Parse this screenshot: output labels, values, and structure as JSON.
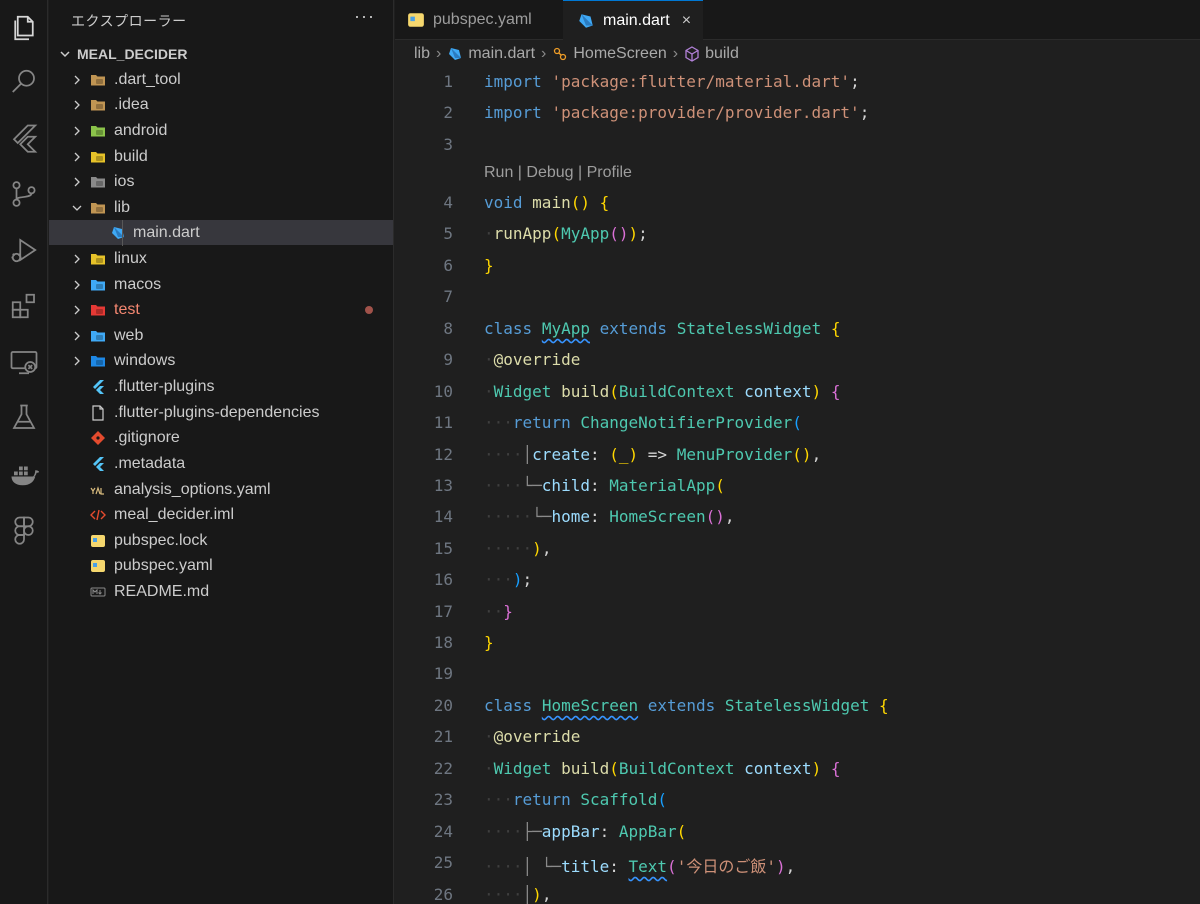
{
  "explorer": {
    "title": "エクスプローラー",
    "more": "···",
    "project": "MEAL_DECIDER",
    "items": [
      {
        "label": ".dart_tool",
        "icon": "folder-icon",
        "color": "#c09553"
      },
      {
        "label": ".idea",
        "icon": "folder-idea-icon",
        "color": "#c09553"
      },
      {
        "label": "android",
        "icon": "folder-android-icon",
        "color": "#8bc34a"
      },
      {
        "label": "build",
        "icon": "folder-build-icon",
        "color": "#e6c229"
      },
      {
        "label": "ios",
        "icon": "folder-ios-icon",
        "color": "#8a8a8a"
      },
      {
        "label": "lib",
        "icon": "folder-lib-icon",
        "color": "#c09553"
      },
      {
        "label": "main.dart",
        "icon": "dart-file-icon",
        "color": "#3fa9f5"
      },
      {
        "label": "linux",
        "icon": "folder-linux-icon",
        "color": "#e6c229"
      },
      {
        "label": "macos",
        "icon": "folder-macos-icon",
        "color": "#3fa9f5"
      },
      {
        "label": "test",
        "icon": "folder-test-icon",
        "color": "#e53935"
      },
      {
        "label": "web",
        "icon": "folder-web-icon",
        "color": "#3fa9f5"
      },
      {
        "label": "windows",
        "icon": "folder-windows-icon",
        "color": "#1e88e5"
      },
      {
        "label": ".flutter-plugins",
        "icon": "flutter-file-icon",
        "color": "#54c5f8"
      },
      {
        "label": ".flutter-plugins-dependencies",
        "icon": "file-icon",
        "color": "#cccccc"
      },
      {
        "label": ".gitignore",
        "icon": "git-file-icon",
        "color": "#e44b2e"
      },
      {
        "label": ".metadata",
        "icon": "flutter-file-icon",
        "color": "#54c5f8"
      },
      {
        "label": "analysis_options.yaml",
        "icon": "yaml-file-icon",
        "color": "#d7ba7d"
      },
      {
        "label": "meal_decider.iml",
        "icon": "xml-file-icon",
        "color": "#e44b2e"
      },
      {
        "label": "pubspec.lock",
        "icon": "pubspec-lock-icon",
        "color": "#f5d76e"
      },
      {
        "label": "pubspec.yaml",
        "icon": "pubspec-yaml-icon",
        "color": "#f5d76e"
      },
      {
        "label": "README.md",
        "icon": "markdown-file-icon",
        "color": "#8a8a8a"
      }
    ]
  },
  "tabs": [
    {
      "label": "pubspec.yaml",
      "icon": "pubspec-yaml-icon"
    },
    {
      "label": "main.dart",
      "icon": "dart-file-icon",
      "close": "×"
    }
  ],
  "breadcrumb": [
    "lib",
    "main.dart",
    "HomeScreen",
    "build"
  ],
  "codelens": "Run | Debug | Profile",
  "line_numbers": [
    "1",
    "2",
    "3",
    "4",
    "5",
    "6",
    "7",
    "8",
    "9",
    "10",
    "11",
    "12",
    "13",
    "14",
    "15",
    "16",
    "17",
    "18",
    "19",
    "20",
    "21",
    "22",
    "23",
    "24",
    "25",
    "26"
  ],
  "code": {
    "l1": [
      "import",
      "'package:flutter/material.dart'",
      ";"
    ],
    "l2": [
      "import",
      "'package:provider/provider.dart'",
      ";"
    ],
    "l4": [
      "void",
      "main",
      "()",
      "{"
    ],
    "l5": [
      "runApp",
      "(",
      "MyApp",
      "()",
      ")",
      ";"
    ],
    "l6": [
      "}"
    ],
    "l8": [
      "class",
      "MyApp",
      "extends",
      "StatelessWidget",
      "{"
    ],
    "l9": [
      "@override"
    ],
    "l10": [
      "Widget",
      "build",
      "(",
      "BuildContext",
      "context",
      ")",
      "{"
    ],
    "l11": [
      "return",
      "ChangeNotifierProvider",
      "("
    ],
    "l12": [
      "create",
      ":",
      "(_)",
      "=>",
      "MenuProvider",
      "()",
      ","
    ],
    "l13": [
      "child",
      ":",
      "MaterialApp",
      "("
    ],
    "l14": [
      "home",
      ":",
      "HomeScreen",
      "()",
      ","
    ],
    "l15": [
      ")",
      ","
    ],
    "l16": [
      ")",
      ";"
    ],
    "l17": [
      "}"
    ],
    "l18": [
      "}"
    ],
    "l20": [
      "class",
      "HomeScreen",
      "extends",
      "StatelessWidget",
      "{"
    ],
    "l21": [
      "@override"
    ],
    "l22": [
      "Widget",
      "build",
      "(",
      "BuildContext",
      "context",
      ")",
      "{"
    ],
    "l23": [
      "return",
      "Scaffold",
      "("
    ],
    "l24": [
      "appBar",
      ":",
      "AppBar",
      "("
    ],
    "l25": [
      "title",
      ":",
      "Text",
      "(",
      "'今日のご飯'",
      ")",
      ","
    ],
    "l26": [
      ")",
      ","
    ]
  }
}
